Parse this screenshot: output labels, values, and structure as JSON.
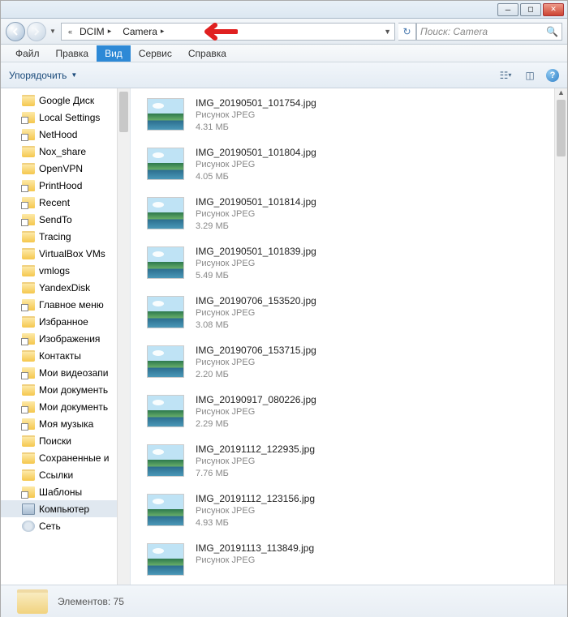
{
  "breadcrumb": {
    "seg1": "DCIM",
    "seg2": "Camera"
  },
  "search": {
    "placeholder": "Поиск: Camera"
  },
  "menu": {
    "file": "Файл",
    "edit": "Правка",
    "view": "Вид",
    "service": "Сервис",
    "help": "Справка"
  },
  "toolbar": {
    "organize": "Упорядочить"
  },
  "tree": [
    {
      "label": "Google Диск",
      "icon": "folder"
    },
    {
      "label": "Local Settings",
      "icon": "shortcut"
    },
    {
      "label": "NetHood",
      "icon": "shortcut"
    },
    {
      "label": "Nox_share",
      "icon": "folder"
    },
    {
      "label": "OpenVPN",
      "icon": "folder"
    },
    {
      "label": "PrintHood",
      "icon": "shortcut"
    },
    {
      "label": "Recent",
      "icon": "shortcut"
    },
    {
      "label": "SendTo",
      "icon": "shortcut"
    },
    {
      "label": "Tracing",
      "icon": "folder"
    },
    {
      "label": "VirtualBox VMs",
      "icon": "folder"
    },
    {
      "label": "vmlogs",
      "icon": "folder"
    },
    {
      "label": "YandexDisk",
      "icon": "folder"
    },
    {
      "label": "Главное меню",
      "icon": "shortcut"
    },
    {
      "label": "Избранное",
      "icon": "folder"
    },
    {
      "label": "Изображения",
      "icon": "shortcut"
    },
    {
      "label": "Контакты",
      "icon": "folder"
    },
    {
      "label": "Мои видеозапи",
      "icon": "shortcut"
    },
    {
      "label": "Мои документь",
      "icon": "folder"
    },
    {
      "label": "Мои документь",
      "icon": "shortcut"
    },
    {
      "label": "Моя музыка",
      "icon": "shortcut"
    },
    {
      "label": "Поиски",
      "icon": "folder"
    },
    {
      "label": "Сохраненные и",
      "icon": "folder"
    },
    {
      "label": "Ссылки",
      "icon": "folder"
    },
    {
      "label": "Шаблоны",
      "icon": "shortcut"
    },
    {
      "label": "Компьютер",
      "icon": "computer",
      "sel": true
    },
    {
      "label": "Сеть",
      "icon": "network"
    }
  ],
  "file_type_label": "Рисунок JPEG",
  "files": [
    {
      "name": "IMG_20190501_101754.jpg",
      "size": "4.31 МБ"
    },
    {
      "name": "IMG_20190501_101804.jpg",
      "size": "4.05 МБ"
    },
    {
      "name": "IMG_20190501_101814.jpg",
      "size": "3.29 МБ"
    },
    {
      "name": "IMG_20190501_101839.jpg",
      "size": "5.49 МБ"
    },
    {
      "name": "IMG_20190706_153520.jpg",
      "size": "3.08 МБ"
    },
    {
      "name": "IMG_20190706_153715.jpg",
      "size": "2.20 МБ"
    },
    {
      "name": "IMG_20190917_080226.jpg",
      "size": "2.29 МБ"
    },
    {
      "name": "IMG_20191112_122935.jpg",
      "size": "7.76 МБ"
    },
    {
      "name": "IMG_20191112_123156.jpg",
      "size": "4.93 МБ"
    },
    {
      "name": "IMG_20191113_113849.jpg",
      "size": ""
    }
  ],
  "status": {
    "label": "Элементов:",
    "count": "75"
  }
}
